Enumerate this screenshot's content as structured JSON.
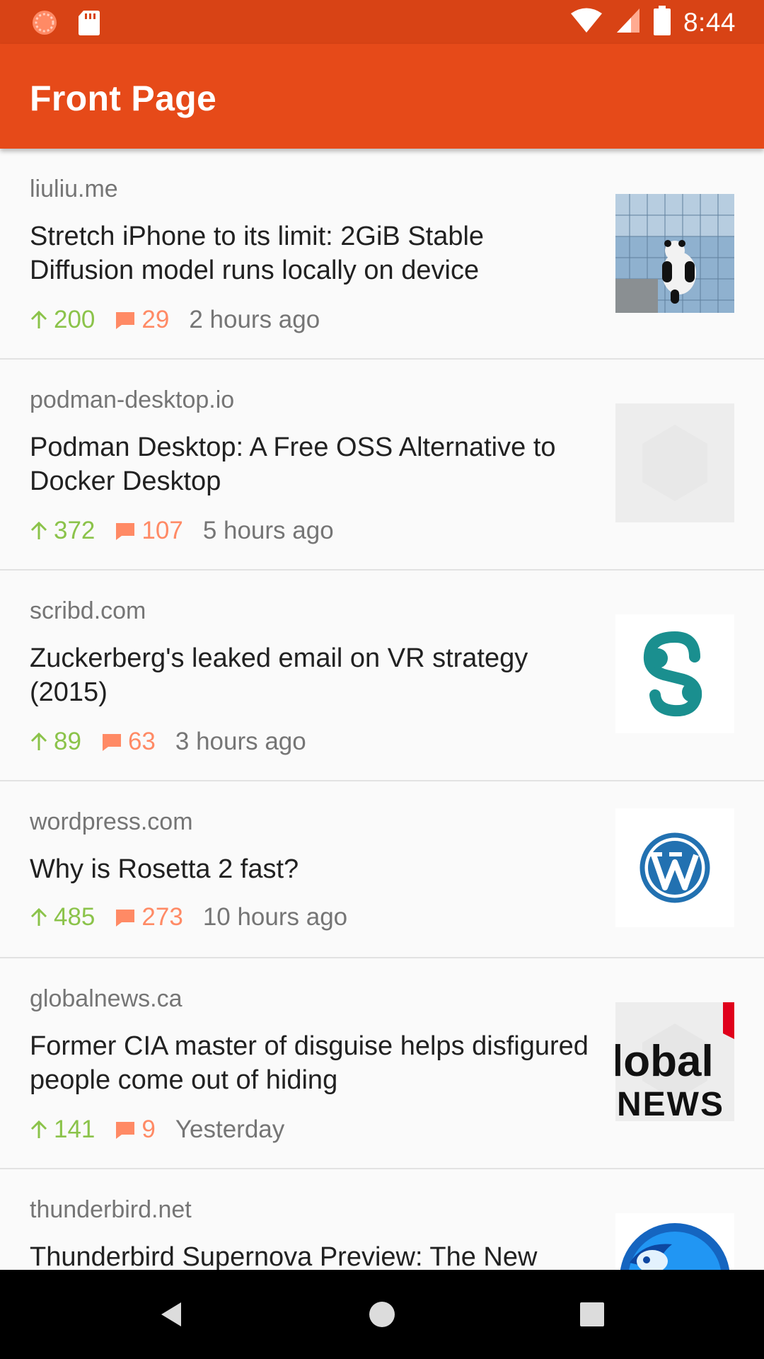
{
  "status_bar": {
    "time": "8:44",
    "icons": [
      "notification-circle-icon",
      "sd-card-icon",
      "wifi-icon",
      "signal-icon",
      "battery-icon"
    ]
  },
  "app_bar": {
    "title": "Front Page"
  },
  "colors": {
    "status_bar": "#d84315",
    "app_bar": "#e64a19",
    "points": "#8bc34a",
    "comments": "#ff8a65"
  },
  "stories": [
    {
      "domain": "liuliu.me",
      "title": "Stretch iPhone to its limit: 2GiB Stable Diffusion model runs locally on device",
      "points": "200",
      "comments": "29",
      "age": "2 hours ago",
      "thumbnail": "panda-building-photo"
    },
    {
      "domain": "podman-desktop.io",
      "title": "Podman Desktop: A Free OSS Alternative to Docker Desktop",
      "points": "372",
      "comments": "107",
      "age": "5 hours ago",
      "thumbnail": "placeholder-hexagon"
    },
    {
      "domain": "scribd.com",
      "title": "Zuckerberg's leaked email on VR strategy (2015)",
      "points": "89",
      "comments": "63",
      "age": "3 hours ago",
      "thumbnail": "scribd-logo"
    },
    {
      "domain": "wordpress.com",
      "title": "Why is Rosetta 2 fast?",
      "points": "485",
      "comments": "273",
      "age": "10 hours ago",
      "thumbnail": "wordpress-logo"
    },
    {
      "domain": "globalnews.ca",
      "title": "Former CIA master of disguise helps disfigured people come out of hiding",
      "points": "141",
      "comments": "9",
      "age": "Yesterday",
      "thumbnail": "global-news-logo",
      "thumbnail_text": [
        "lobal",
        "NEWS"
      ]
    },
    {
      "domain": "thunderbird.net",
      "title": "Thunderbird Supernova Preview: The New",
      "thumbnail": "thunderbird-logo"
    }
  ],
  "nav_bar": {
    "buttons": [
      "back-button",
      "home-button",
      "recents-button"
    ]
  }
}
